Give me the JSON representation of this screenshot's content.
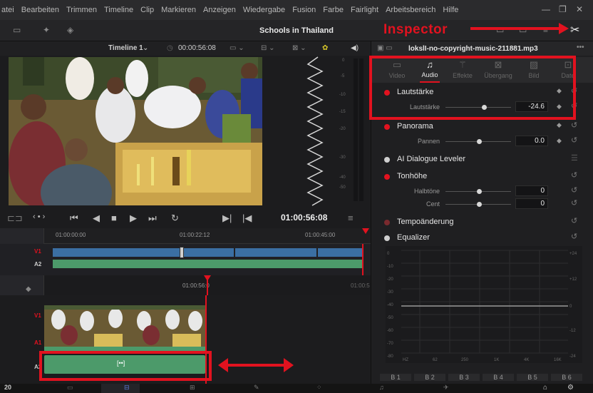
{
  "menu": [
    "atei",
    "Bearbeiten",
    "Trimmen",
    "Timeline",
    "Clip",
    "Markieren",
    "Anzeigen",
    "Wiedergabe",
    "Fusion",
    "Farbe",
    "Fairlight",
    "Arbeitsbereich",
    "Hilfe"
  ],
  "project_title": "Schools in Thailand",
  "annotation": "Inspector",
  "viewer_bar": {
    "timeline_name": "Timeline 1",
    "timecode": "00:00:56:08"
  },
  "transport": {
    "timecode": "01:00:56:08"
  },
  "ruler_top": [
    "01:00:00:00",
    "01:00:22:12",
    "01:00:45:00"
  ],
  "ruler_bottom": [
    "01:00:56:0",
    "01:00:5"
  ],
  "tracks": {
    "v1": "V1",
    "a2": "A2",
    "a1": "A1"
  },
  "clip_icon": "[••]",
  "inspector": {
    "file_name": "lokslI-no-copyright-music-211881.mp3",
    "tabs": [
      "Video",
      "Audio",
      "Effekte",
      "Übergang",
      "Bild",
      "Date"
    ],
    "volume": {
      "title": "Lautstärke",
      "label": "Lautstärke",
      "value": "-24.6"
    },
    "pan": {
      "title": "Panorama",
      "label": "Pannen",
      "value": "0.0"
    },
    "dialogue": {
      "title": "AI Dialogue Leveler"
    },
    "pitch": {
      "title": "Tonhöhe",
      "semi_label": "Halbtöne",
      "semi_value": "0",
      "cent_label": "Cent",
      "cent_value": "0"
    },
    "tempo": {
      "title": "Tempoänderung"
    },
    "eq": {
      "title": "Equalizer",
      "left_scale": [
        "0",
        "-10",
        "-20",
        "-30",
        "-40",
        "-50",
        "-60",
        "-70",
        "-80"
      ],
      "right_scale": [
        "+24",
        "+12",
        "0",
        "-12",
        "-24"
      ],
      "freq_labels": [
        "HZ",
        "62",
        "250",
        "1K",
        "4K",
        "16K"
      ],
      "bands": [
        "B 1",
        "B 2",
        "B 3",
        "B 4",
        "B 5",
        "B 6"
      ]
    }
  },
  "bottom_left": "20",
  "colors": {
    "accent": "#e2121f",
    "clip_video": "#3b6fa3",
    "clip_audio": "#4c9a6a"
  }
}
